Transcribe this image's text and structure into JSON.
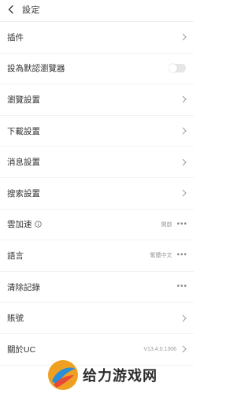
{
  "header": {
    "title": "設定"
  },
  "rows": [
    {
      "label": "插件"
    },
    {
      "label": "設為默認瀏覽器"
    },
    {
      "label": "瀏覽設置"
    },
    {
      "label": "下載設置"
    },
    {
      "label": "消息設置"
    },
    {
      "label": "搜索設置"
    },
    {
      "label": "雲加速",
      "value": "開啟"
    },
    {
      "label": "語言",
      "value": "繁體中文"
    },
    {
      "label": "清除記錄"
    },
    {
      "label": "賬號"
    },
    {
      "label": "關於UC",
      "value": "V13.4.0.1306"
    }
  ],
  "toggle": {
    "state": "off"
  },
  "watermark": {
    "text": "给力游戏网",
    "logo_colors": [
      "#f0a020",
      "#2a8fd8",
      "#e84a3a"
    ]
  },
  "icons": {
    "back": "chevron-left-icon",
    "chevron": "chevron-right-icon",
    "more": "more-dots-icon",
    "info": "info-icon"
  }
}
